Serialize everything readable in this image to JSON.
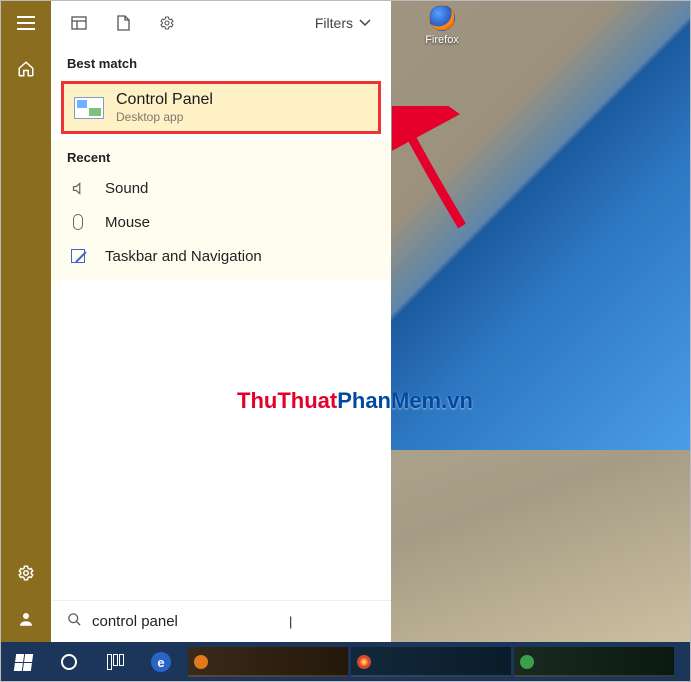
{
  "rail": {
    "hamburger_name": "menu",
    "home_name": "home",
    "settings_name": "settings",
    "user_name": "user-account"
  },
  "topbar": {
    "filters_label": "Filters"
  },
  "best": {
    "header": "Best match",
    "title": "Control Panel",
    "subtitle": "Desktop app"
  },
  "recent": {
    "header": "Recent",
    "items": [
      {
        "label": "Sound",
        "icon": "speaker-icon"
      },
      {
        "label": "Mouse",
        "icon": "mouse-icon"
      },
      {
        "label": "Taskbar and Navigation",
        "icon": "taskbar-icon"
      }
    ]
  },
  "search": {
    "value": "control panel"
  },
  "desktop": {
    "firefox_label": "Firefox"
  },
  "watermark": {
    "part1": "ThuThuat",
    "part2": "PhanMem.vn"
  }
}
